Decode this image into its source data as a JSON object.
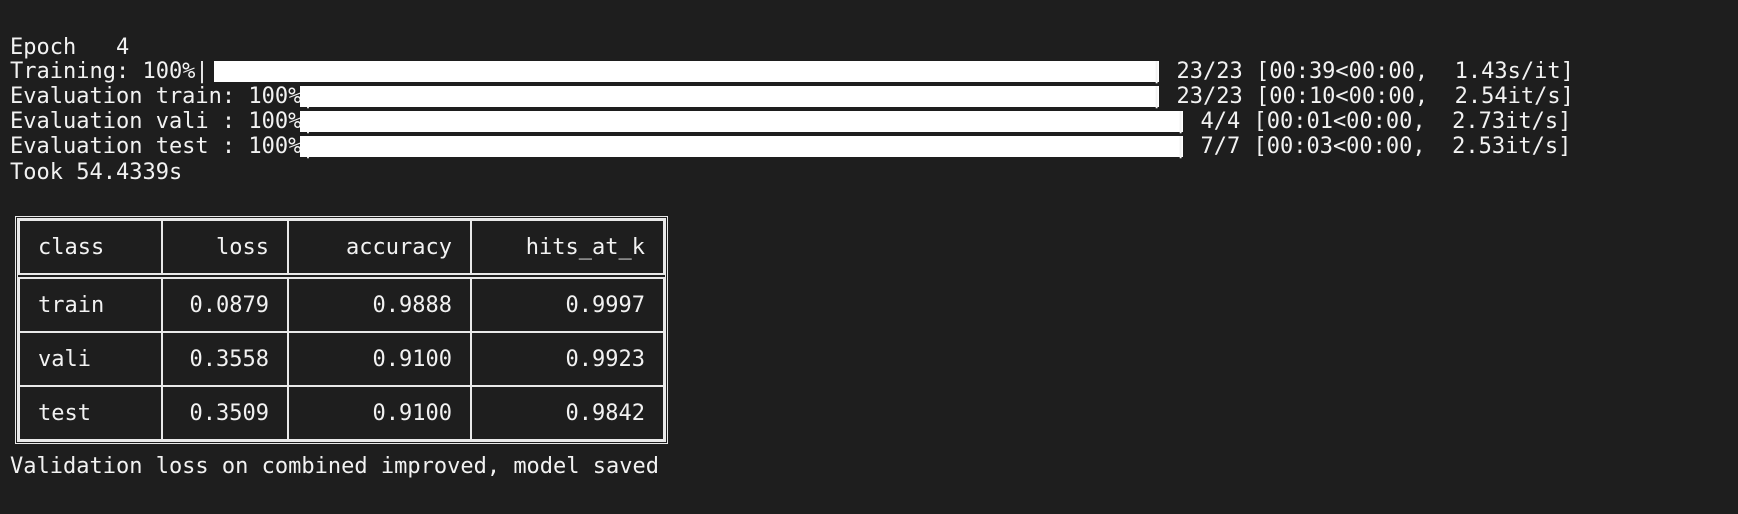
{
  "epoch_line": "Epoch   4",
  "progress_bars": [
    {
      "prefix": "Training: 100%|",
      "suffix": "| 23/23 [00:39<00:00,  1.43s/it]",
      "progress": 1.0
    },
    {
      "prefix": "Evaluation train: 100%|",
      "suffix": "| 23/23 [00:10<00:00,  2.54it/s]",
      "progress": 1.0
    },
    {
      "prefix": "Evaluation vali : 100%|",
      "suffix": "| 4/4 [00:01<00:00,  2.73it/s]",
      "progress": 1.0
    },
    {
      "prefix": "Evaluation test : 100%|",
      "suffix": "| 7/7 [00:03<00:00,  2.53it/s]",
      "progress": 1.0
    }
  ],
  "took_line": "Took 54.4339s",
  "metrics_table": {
    "columns": [
      "class",
      "loss",
      "accuracy",
      "hits_at_k"
    ],
    "rows": [
      [
        "train",
        "0.0879",
        "0.9888",
        "0.9997"
      ],
      [
        "vali",
        "0.3558",
        "0.9100",
        "0.9923"
      ],
      [
        "test",
        "0.3509",
        "0.9100",
        "0.9842"
      ]
    ]
  },
  "status_line": "Validation loss on combined improved, model saved"
}
